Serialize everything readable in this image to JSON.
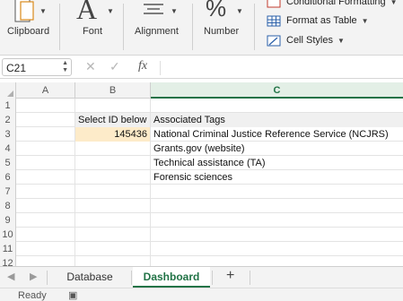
{
  "ribbon": {
    "clipboard_label": "Clipboard",
    "font_label": "Font",
    "font_glyph": "A",
    "alignment_label": "Alignment",
    "number_label": "Number",
    "number_glyph": "%",
    "conditional_formatting_label": "Conditional Formatting",
    "format_as_table_label": "Format as Table",
    "cell_styles_label": "Cell Styles"
  },
  "formula_bar": {
    "name_box_value": "C21",
    "fx_label": "fx",
    "formula_value": ""
  },
  "columns": [
    "A",
    "B",
    "C"
  ],
  "selected_column": "C",
  "rows": [
    {
      "num": "1",
      "a": "",
      "b": "",
      "c": ""
    },
    {
      "num": "2",
      "a": "",
      "b": "Select ID below",
      "c": "Associated Tags"
    },
    {
      "num": "3",
      "a": "",
      "b": "145436",
      "c": "National Criminal Justice Reference Service (NCJRS)"
    },
    {
      "num": "4",
      "a": "",
      "b": "",
      "c": "Grants.gov (website)"
    },
    {
      "num": "5",
      "a": "",
      "b": "",
      "c": "Technical assistance (TA)"
    },
    {
      "num": "6",
      "a": "",
      "b": "",
      "c": "Forensic sciences"
    },
    {
      "num": "7",
      "a": "",
      "b": "",
      "c": ""
    },
    {
      "num": "8",
      "a": "",
      "b": "",
      "c": ""
    },
    {
      "num": "9",
      "a": "",
      "b": "",
      "c": ""
    },
    {
      "num": "10",
      "a": "",
      "b": "",
      "c": ""
    },
    {
      "num": "11",
      "a": "",
      "b": "",
      "c": ""
    },
    {
      "num": "12",
      "a": "",
      "b": "",
      "c": ""
    }
  ],
  "sheet_tabs": [
    {
      "label": "Database",
      "active": false
    },
    {
      "label": "Dashboard",
      "active": true
    }
  ],
  "add_sheet_label": "+",
  "status": {
    "text": "Ready"
  },
  "colors": {
    "accent": "#217346",
    "highlight_cell": "#fdebc9"
  }
}
